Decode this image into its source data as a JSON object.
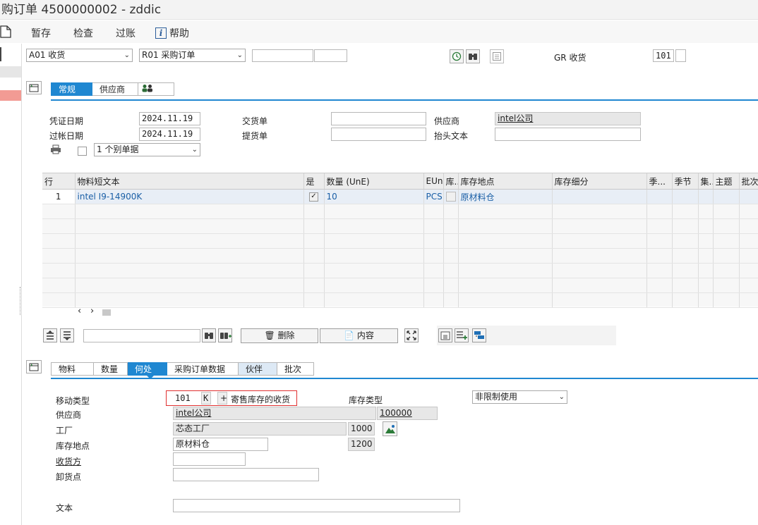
{
  "window": {
    "title": "购订单 4500000002 - zddic"
  },
  "toolbar": {
    "save": "暂存",
    "check": "检查",
    "post": "过账",
    "help": "帮助"
  },
  "header_bar": {
    "action": "A01 收货",
    "reference": "R01 采购订单",
    "po_number": "",
    "po_item": "",
    "gr_label": "GR 收货",
    "movement_type": "101"
  },
  "header_tabs": [
    {
      "label": "常规"
    },
    {
      "label": "供应商"
    }
  ],
  "general": {
    "doc_date_label": "凭证日期",
    "doc_date": "2024.11.19",
    "post_date_label": "过帐日期",
    "post_date": "2024.11.19",
    "delivery_note_label": "交货单",
    "delivery_note": "",
    "bill_of_lading_label": "提货单",
    "bill_of_lading": "",
    "vendor_label": "供应商",
    "vendor": "intel公司",
    "header_text_label": "抬头文本",
    "header_text": "",
    "print_option": "1 个别单据"
  },
  "item_table": {
    "headers": [
      "行",
      "物料短文本",
      "是",
      "数量 (UnE)",
      "EUn",
      "库...",
      "库存地点",
      "库存细分",
      "季...",
      "季节",
      "集...",
      "主题",
      "批次"
    ],
    "rows": [
      {
        "line": "1",
        "material": "intel I9-14900K",
        "ok": "✓",
        "qty": "10",
        "unit": "PCS",
        "sloc": "原材料仓"
      }
    ]
  },
  "table_toolbar": {
    "delete": "删除",
    "content": "内容"
  },
  "detail_tabs": [
    {
      "label": "物料"
    },
    {
      "label": "数量"
    },
    {
      "label": "何处"
    },
    {
      "label": "采购订单数据"
    },
    {
      "label": "伙伴"
    },
    {
      "label": "批次"
    }
  ],
  "detail": {
    "mvt_label": "移动类型",
    "mvt": "101",
    "mvt_k": "K",
    "mvt_plus": "+",
    "mvt_text": "寄售库存的收货",
    "stock_type_label": "库存类型",
    "stock_type": "非限制使用",
    "vendor_label": "供应商",
    "vendor": "intel公司",
    "vendor_code": "100000",
    "plant_label": "工厂",
    "plant": "芯态工厂",
    "plant_code": "1000",
    "sloc_label": "库存地点",
    "sloc": "原材料仓",
    "sloc_code": "1200",
    "recipient_label": "收货方",
    "recipient": "",
    "unloading_label": "卸货点",
    "unloading": "",
    "text_label": "文本",
    "text": ""
  }
}
